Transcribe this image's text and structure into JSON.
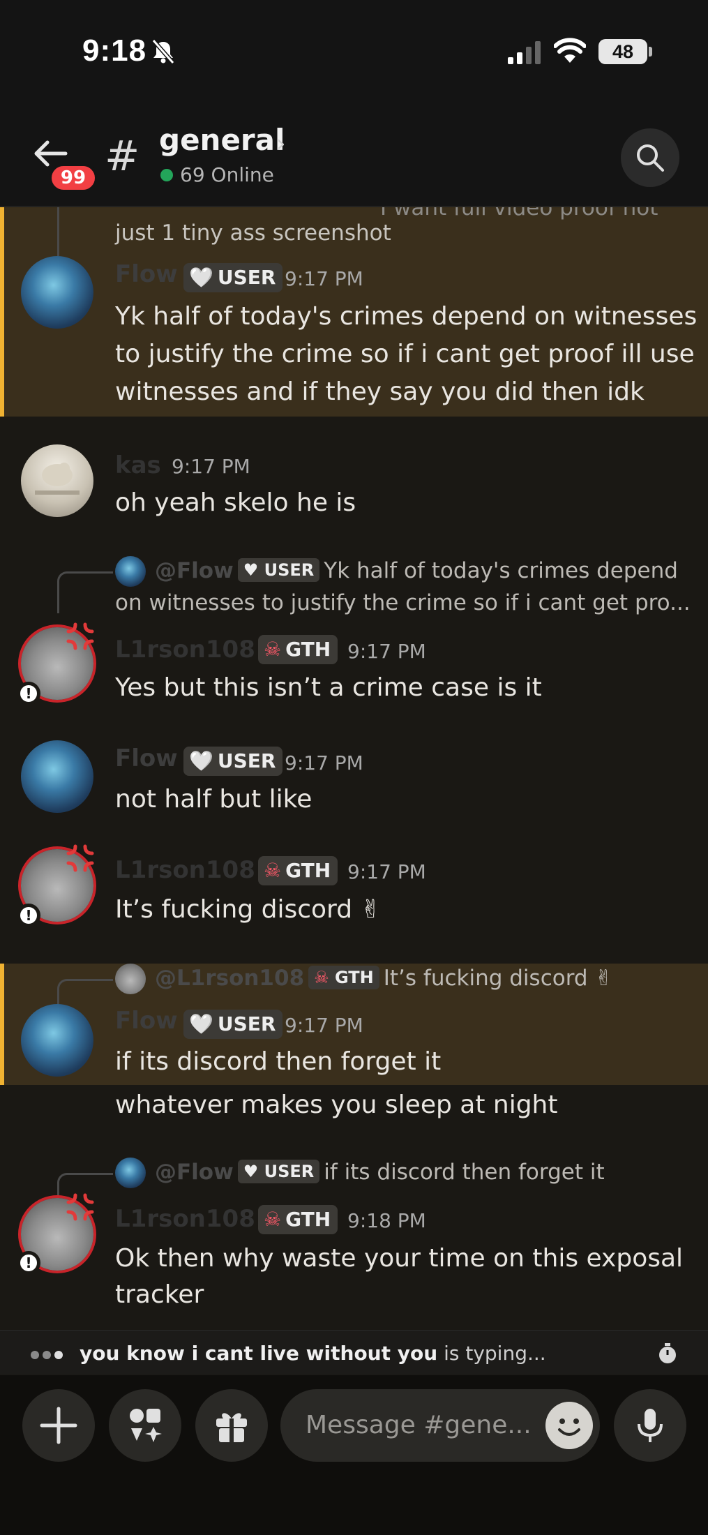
{
  "status_bar": {
    "time": "9:18",
    "battery": "48"
  },
  "header": {
    "channel": "general",
    "online": "69 Online",
    "unread_badge": "99"
  },
  "messages": {
    "top_reply_fragment": "I want full video proof not",
    "m1": {
      "continuation": "just 1 tiny ass screenshot",
      "author": "Flow",
      "tag": "USER",
      "time": "9:17 PM",
      "lines": [
        "Yk half of today's crimes depend on witnesses",
        "to justify the crime so if i cant get proof ill use",
        "witnesses and if they say you did then idk"
      ]
    },
    "m2": {
      "author": "kas",
      "time": "9:17 PM",
      "text": "oh yeah skelo he is"
    },
    "m3": {
      "reply_author": "@Flow",
      "reply_tag": "USER",
      "reply_line1": "Yk half of today's crimes depend",
      "reply_line2": "on witnesses to justify the crime so if i cant get pro...",
      "author": "L1rson108",
      "tag": "GTH",
      "time": "9:17 PM",
      "text": "Yes but this isn’t a crime case is it"
    },
    "m4": {
      "author": "Flow",
      "tag": "USER",
      "time": "9:17 PM",
      "text": "not half but like"
    },
    "m5": {
      "author": "L1rson108",
      "tag": "GTH",
      "time": "9:17 PM",
      "text": "It’s fucking discord ✌"
    },
    "m6": {
      "reply_author": "@L1rson108",
      "reply_tag": "GTH",
      "reply_text": "It’s fucking discord ✌",
      "author": "Flow",
      "tag": "USER",
      "time": "9:17 PM",
      "text": "if its discord then forget it",
      "text2": "whatever makes you sleep at night"
    },
    "m7": {
      "reply_author": "@Flow",
      "reply_tag": "USER",
      "reply_text": "if its discord then forget it",
      "author": "L1rson108",
      "tag": "GTH",
      "time": "9:18 PM",
      "line1": "Ok then why waste your time on this exposal",
      "line2": "tracker"
    }
  },
  "typing": {
    "who": "you know i cant live without you",
    "suffix": " is typing..."
  },
  "composer": {
    "placeholder": "Message #gene..."
  },
  "colors": {
    "accent_yellow": "#f0b232",
    "online_green": "#23a55a",
    "badge_red": "#f23f43"
  }
}
